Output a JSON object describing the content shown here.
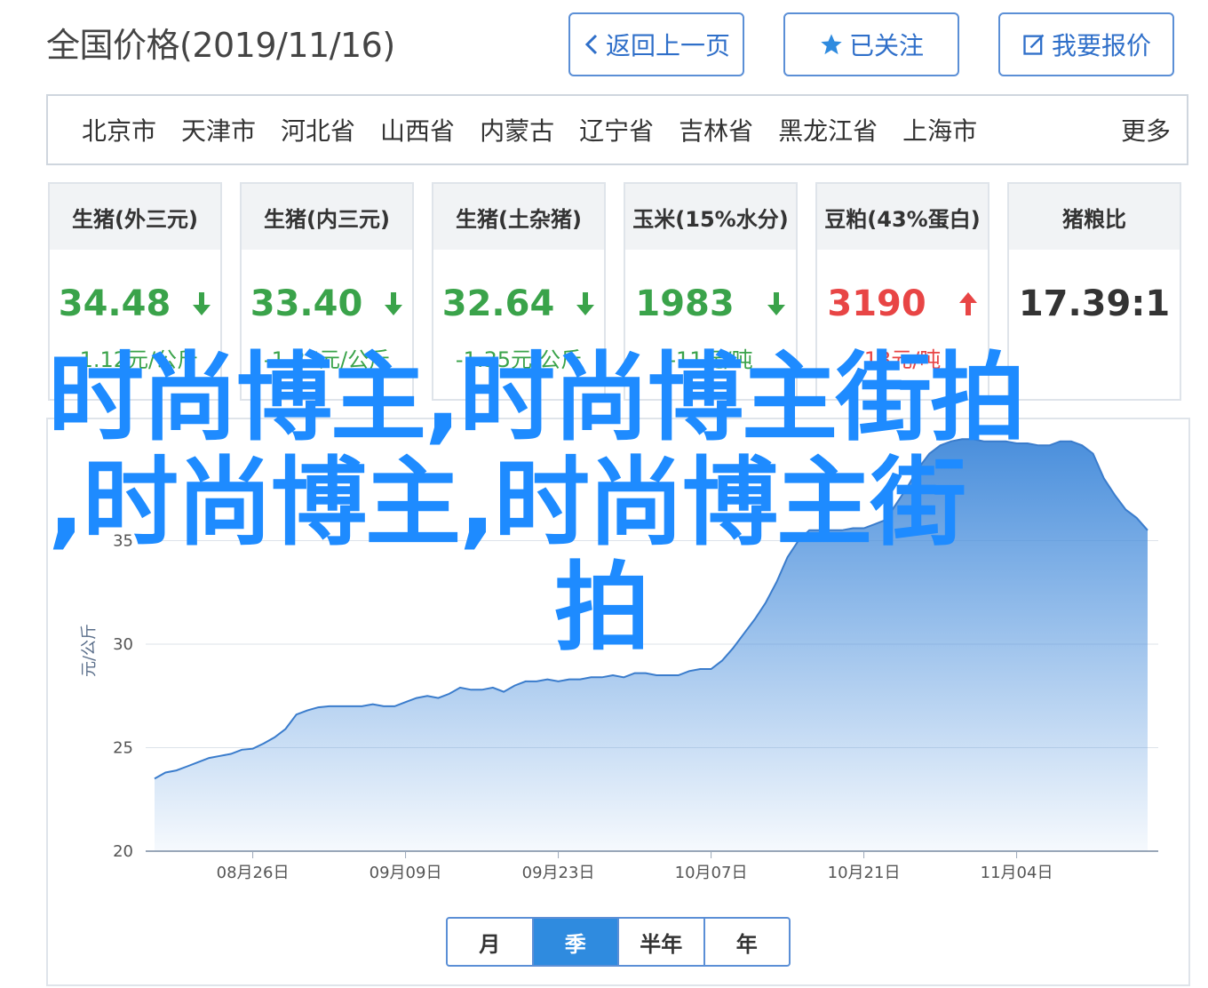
{
  "header": {
    "title": "全国价格(2019/11/16)",
    "back_label": "返回上一页",
    "follow_label": "已关注",
    "report_label": "我要报价"
  },
  "regions": [
    "北京市",
    "天津市",
    "河北省",
    "山西省",
    "内蒙古",
    "辽宁省",
    "吉林省",
    "黑龙江省",
    "上海市"
  ],
  "regions_more": "更多",
  "cards": [
    {
      "title": "生猪(外三元)",
      "value": "34.48",
      "change": "-1.12元/公斤",
      "trend": "down"
    },
    {
      "title": "生猪(内三元)",
      "value": "33.40",
      "change": "-1.37元/公斤",
      "trend": "down"
    },
    {
      "title": "生猪(土杂猪)",
      "value": "32.64",
      "change": "-1.35元/公斤",
      "trend": "down"
    },
    {
      "title": "玉米(15%水分)",
      "value": "1983",
      "change": "-11元/吨",
      "trend": "down"
    },
    {
      "title": "豆粕(43%蛋白)",
      "value": "3190",
      "change": "13元/吨",
      "trend": "up"
    },
    {
      "title": "猪粮比",
      "value": "17.39:1",
      "change": "",
      "trend": "none"
    }
  ],
  "overlay_text": [
    "时尚博主,时尚博主街拍",
    ",时尚博主,时尚博主街",
    "拍"
  ],
  "colors": {
    "accent": "#2f6fc9",
    "down": "#3aa34a",
    "up": "#e84545",
    "overlay": "#1e8bff",
    "area": "#4a8fdc"
  },
  "period_tabs": [
    {
      "label": "月",
      "active": false
    },
    {
      "label": "季",
      "active": true
    },
    {
      "label": "半年",
      "active": false
    },
    {
      "label": "年",
      "active": false
    }
  ],
  "chart_data": {
    "type": "area",
    "ylabel": "元/公斤",
    "ylim": [
      20,
      40
    ],
    "yticks": [
      20,
      25,
      30,
      35
    ],
    "xtick_labels": [
      "08月26日",
      "09月09日",
      "09月23日",
      "10月07日",
      "10月21日",
      "11月04日"
    ],
    "x": [
      "08-17",
      "08-18",
      "08-19",
      "08-20",
      "08-21",
      "08-22",
      "08-23",
      "08-24",
      "08-25",
      "08-26",
      "08-27",
      "08-28",
      "08-29",
      "08-30",
      "08-31",
      "09-01",
      "09-02",
      "09-03",
      "09-04",
      "09-05",
      "09-06",
      "09-07",
      "09-08",
      "09-09",
      "09-10",
      "09-11",
      "09-12",
      "09-13",
      "09-14",
      "09-15",
      "09-16",
      "09-17",
      "09-18",
      "09-19",
      "09-20",
      "09-21",
      "09-22",
      "09-23",
      "09-24",
      "09-25",
      "09-26",
      "09-27",
      "09-28",
      "09-29",
      "09-30",
      "10-01",
      "10-02",
      "10-03",
      "10-04",
      "10-05",
      "10-06",
      "10-07",
      "10-08",
      "10-09",
      "10-10",
      "10-11",
      "10-12",
      "10-13",
      "10-14",
      "10-15",
      "10-16",
      "10-17",
      "10-18",
      "10-19",
      "10-20",
      "10-21",
      "10-22",
      "10-23",
      "10-24",
      "10-25",
      "10-26",
      "10-27",
      "10-28",
      "10-29",
      "10-30",
      "10-31",
      "11-01",
      "11-02",
      "11-03",
      "11-04",
      "11-05",
      "11-06",
      "11-07",
      "11-08",
      "11-09",
      "11-10",
      "11-11",
      "11-12",
      "11-13",
      "11-14",
      "11-15",
      "11-16"
    ],
    "values": [
      23.5,
      23.8,
      23.9,
      24.1,
      24.3,
      24.5,
      24.6,
      24.7,
      24.9,
      24.95,
      25.2,
      25.5,
      25.9,
      26.6,
      26.8,
      26.95,
      27.0,
      27.0,
      27.0,
      27.0,
      27.1,
      27.0,
      27.0,
      27.2,
      27.4,
      27.5,
      27.4,
      27.6,
      27.9,
      27.8,
      27.8,
      27.9,
      27.7,
      28.0,
      28.2,
      28.2,
      28.3,
      28.2,
      28.3,
      28.3,
      28.4,
      28.4,
      28.5,
      28.4,
      28.6,
      28.6,
      28.5,
      28.5,
      28.5,
      28.7,
      28.8,
      28.8,
      29.2,
      29.8,
      30.5,
      31.2,
      32.0,
      33.0,
      34.2,
      35.0,
      35.5,
      35.5,
      35.5,
      35.5,
      35.6,
      35.6,
      35.8,
      36.0,
      36.8,
      37.6,
      38.5,
      39.2,
      39.6,
      39.8,
      39.9,
      39.9,
      39.8,
      39.8,
      39.8,
      39.7,
      39.7,
      39.6,
      39.6,
      39.8,
      39.8,
      39.6,
      39.2,
      38.0,
      37.2,
      36.5,
      36.1,
      35.5
    ]
  }
}
